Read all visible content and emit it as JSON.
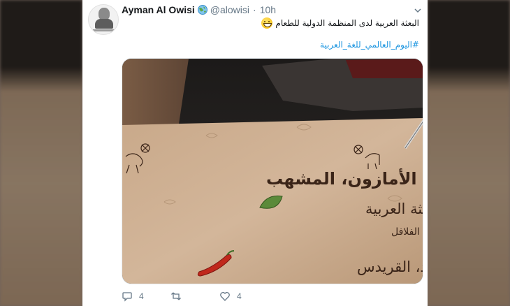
{
  "tweet": {
    "author_name": "Ayman Al Owisi",
    "handle": "@alowisi",
    "separator": "·",
    "time": "10h",
    "text_line1": "البعثة العربية لدى المنظمة الدولية للطعام",
    "hashtag": "#اليوم_العالمي_للغة_العربية"
  },
  "menu_card": {
    "section_heading": "الأمازون، المشهب",
    "item1_title": "البعثة العربية",
    "item1_desc": "(حمص،تبولة،متبل، محشو بأوراق الكرمة مع الفلافل",
    "item2_title": "جوزة الهند، القريدس"
  },
  "actions": {
    "reply_count": "4",
    "retweet_count": "",
    "like_count": "4"
  },
  "icons": {
    "verified": "globe-icon",
    "menu": "chevron-down-icon",
    "reply": "reply-icon",
    "retweet": "retweet-icon",
    "like": "heart-icon",
    "emoji": "grinning-face-icon"
  },
  "colors": {
    "link": "#1b95e0",
    "text": "#14171a",
    "muted": "#657786"
  }
}
